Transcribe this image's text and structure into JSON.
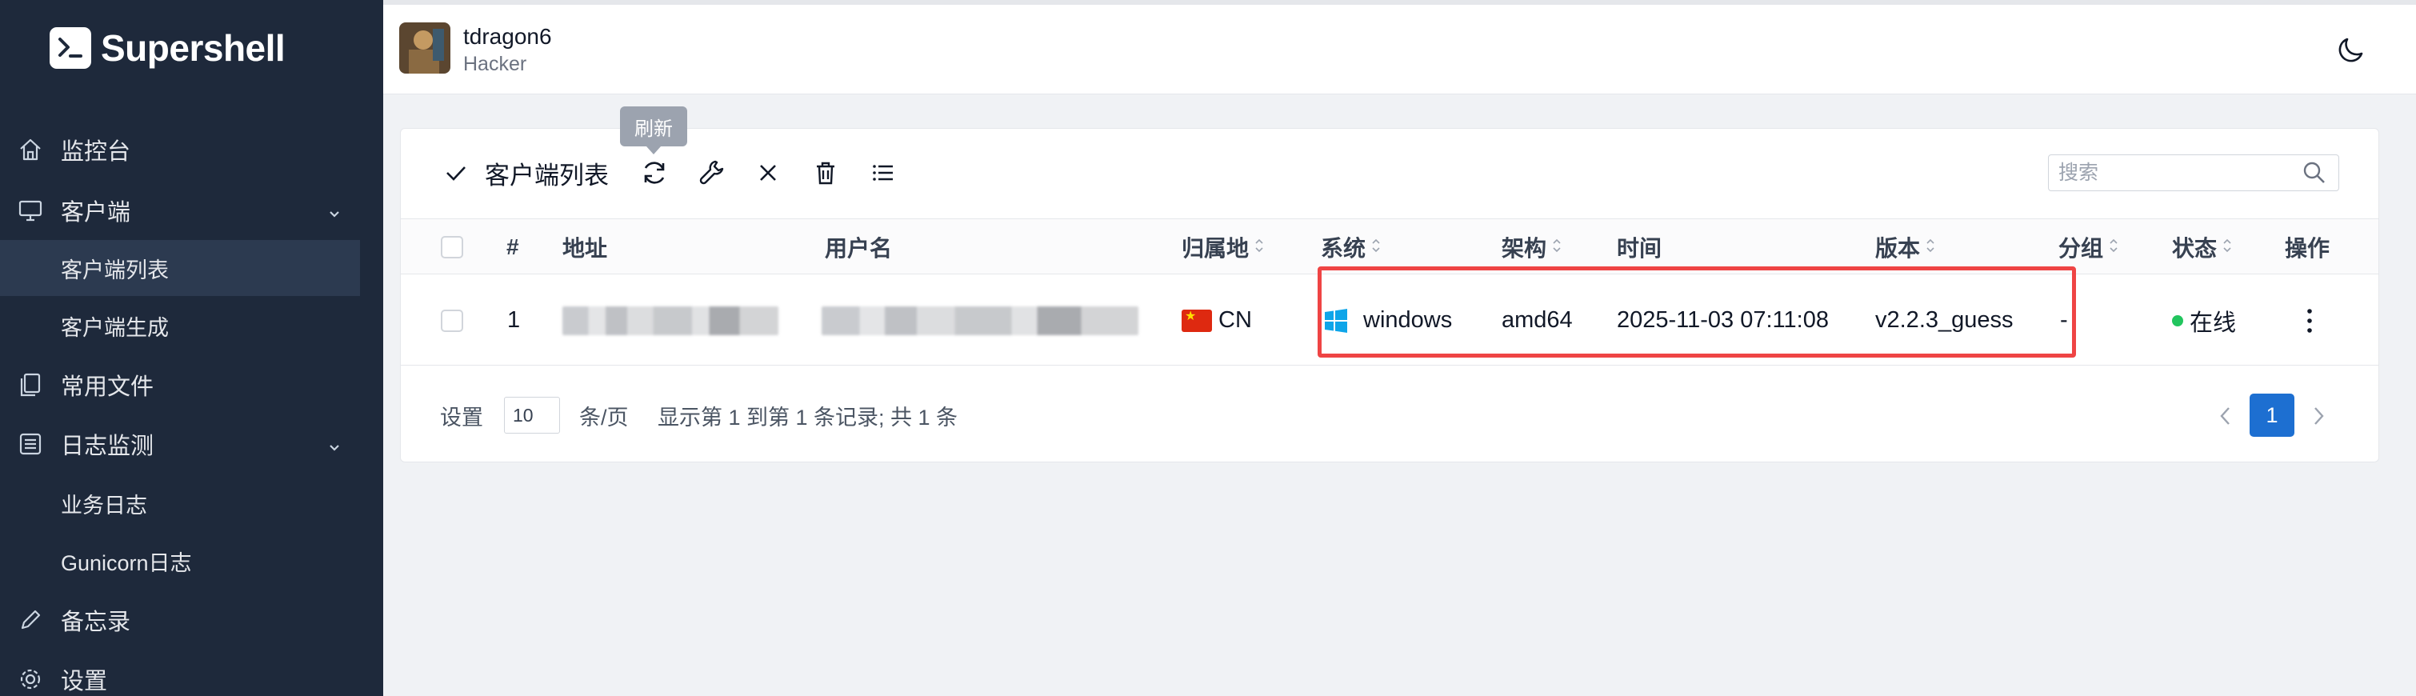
{
  "app": {
    "name": "Supershell"
  },
  "sidebar": {
    "items": [
      {
        "label": "监控台",
        "icon": "home-icon"
      },
      {
        "label": "客户端",
        "icon": "monitor-icon"
      },
      {
        "label": "客户端列表"
      },
      {
        "label": "客户端生成"
      },
      {
        "label": "常用文件",
        "icon": "files-icon"
      },
      {
        "label": "日志监测",
        "icon": "list-icon"
      },
      {
        "label": "业务日志"
      },
      {
        "label": "Gunicorn日志"
      },
      {
        "label": "备忘录",
        "icon": "pencil-icon"
      },
      {
        "label": "设置",
        "icon": "gear-icon"
      }
    ]
  },
  "header": {
    "username": "tdragon6",
    "role": "Hacker"
  },
  "toolbar": {
    "title": "客户端列表",
    "tooltip": "刷新",
    "search_placeholder": "搜索"
  },
  "table": {
    "columns": [
      "#",
      "地址",
      "用户名",
      "归属地",
      "系统",
      "架构",
      "时间",
      "版本",
      "分组",
      "状态",
      "操作"
    ],
    "rows": [
      {
        "index": "1",
        "location": "CN",
        "system": "windows",
        "arch": "amd64",
        "time": "2025-11-03 07:11:08",
        "version": "v2.2.3_guess",
        "group": "-",
        "status": "在线"
      }
    ]
  },
  "footer": {
    "settings_label": "设置",
    "page_size": "10",
    "per_page_label": "条/页",
    "summary": "显示第 1 到第 1 条记录; 共 1 条",
    "current_page": "1"
  },
  "colors": {
    "sidebar_bg": "#1e293b",
    "accent": "#1d6fd1",
    "online": "#22c55e",
    "highlight": "#ef4444"
  }
}
